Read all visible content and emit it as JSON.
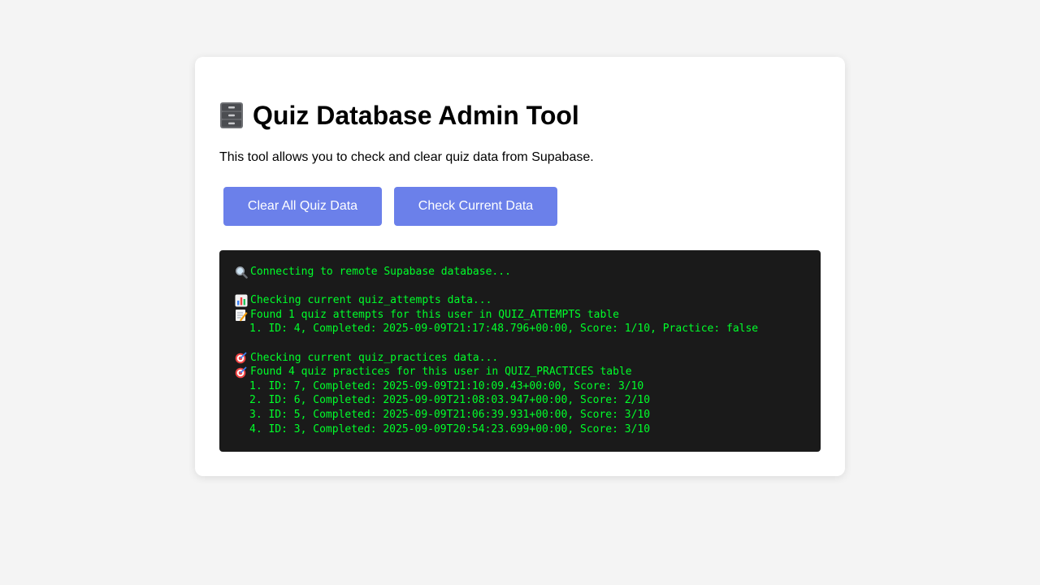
{
  "page": {
    "title": "Quiz Database Admin Tool",
    "title_icon": "file-cabinet-icon",
    "description": "This tool allows you to check and clear quiz data from Supabase."
  },
  "buttons": {
    "clear_label": "Clear All Quiz Data",
    "check_label": "Check Current Data"
  },
  "colors": {
    "background": "#f4f4f4",
    "button": "#6b80ea",
    "console_bg": "#1a1a1a",
    "console_text": "#00ff2a"
  },
  "console": {
    "connecting": {
      "icon": "magnifier-icon",
      "text": "Connecting to remote Supabase database..."
    },
    "attempts_check": {
      "icon": "bar-chart-icon",
      "text": "Checking current quiz_attempts data..."
    },
    "attempts_found": {
      "icon": "memo-icon",
      "text": "Found 1 quiz attempts for this user in QUIZ_ATTEMPTS table"
    },
    "attempts_rows": [
      "1. ID: 4, Completed: 2025-09-09T21:17:48.796+00:00, Score: 1/10, Practice: false"
    ],
    "practices_check": {
      "icon": "target-icon",
      "text": "Checking current quiz_practices data..."
    },
    "practices_found": {
      "icon": "target-icon",
      "text": "Found 4 quiz practices for this user in QUIZ_PRACTICES table"
    },
    "practices_rows": [
      "1. ID: 7, Completed: 2025-09-09T21:10:09.43+00:00, Score: 3/10",
      "2. ID: 6, Completed: 2025-09-09T21:08:03.947+00:00, Score: 2/10",
      "3. ID: 5, Completed: 2025-09-09T21:06:39.931+00:00, Score: 3/10",
      "4. ID: 3, Completed: 2025-09-09T20:54:23.699+00:00, Score: 3/10"
    ]
  }
}
